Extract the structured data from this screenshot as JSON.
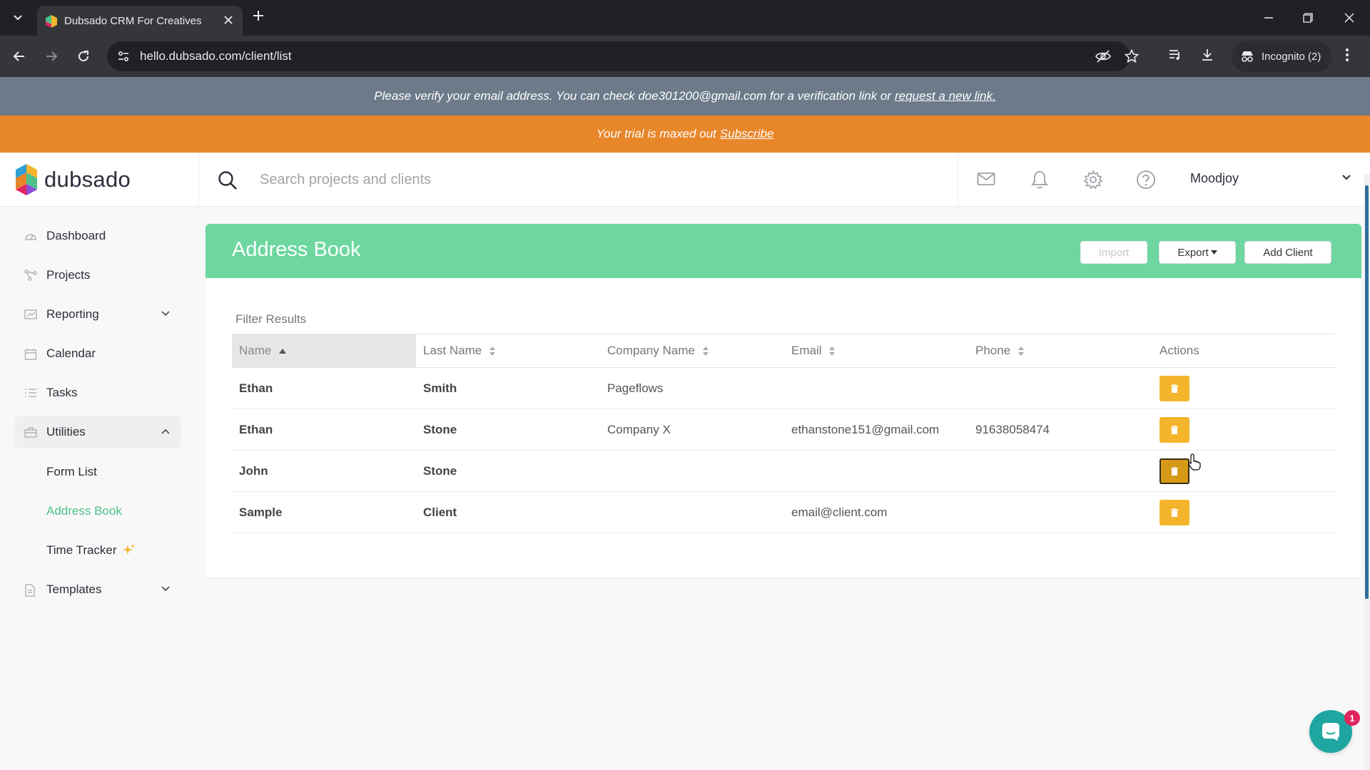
{
  "browser": {
    "tab_title": "Dubsado CRM For Creatives",
    "url": "hello.dubsado.com/client/list",
    "incognito_label": "Incognito (2)"
  },
  "banners": {
    "verify_text": "Please verify your email address. You can check doe301200@gmail.com for a verification link or",
    "verify_link": "request a new link.",
    "trial_text": "Your trial is maxed out",
    "trial_link": "Subscribe"
  },
  "header": {
    "logo_text": "dubsado",
    "search_placeholder": "Search projects and clients",
    "user_name": "Moodjoy"
  },
  "sidebar": {
    "items": [
      {
        "label": "Dashboard",
        "icon": "dashboard-icon"
      },
      {
        "label": "Projects",
        "icon": "projects-icon"
      },
      {
        "label": "Reporting",
        "icon": "reporting-icon"
      },
      {
        "label": "Calendar",
        "icon": "calendar-icon"
      },
      {
        "label": "Tasks",
        "icon": "tasks-icon"
      },
      {
        "label": "Utilities",
        "icon": "utilities-icon"
      },
      {
        "label": "Templates",
        "icon": "templates-icon"
      }
    ],
    "sub_items": [
      "Form List",
      "Address Book",
      "Time Tracker"
    ],
    "active_sub": "Address Book"
  },
  "page": {
    "title": "Address Book",
    "import_label": "Import",
    "export_label": "Export",
    "add_client_label": "Add Client",
    "filter_label": "Filter Results"
  },
  "table": {
    "columns": [
      "Name",
      "Last Name",
      "Company Name",
      "Email",
      "Phone",
      "Actions"
    ],
    "rows": [
      {
        "name": "Ethan",
        "last_name": "Smith",
        "company": "Pageflows",
        "email": "",
        "phone": ""
      },
      {
        "name": "Ethan",
        "last_name": "Stone",
        "company": "Company X",
        "email": "ethanstone151@gmail.com",
        "phone": "91638058474"
      },
      {
        "name": "John",
        "last_name": "Stone",
        "company": "",
        "email": "",
        "phone": ""
      },
      {
        "name": "Sample",
        "last_name": "Client",
        "company": "",
        "email": "email@client.com",
        "phone": ""
      }
    ]
  },
  "chat": {
    "badge_count": "1"
  },
  "colors": {
    "accent_green": "#6dd79f",
    "trial_orange": "#e8862a",
    "verify_gray": "#6c7a8a",
    "delete_yellow": "#f4b52c"
  }
}
